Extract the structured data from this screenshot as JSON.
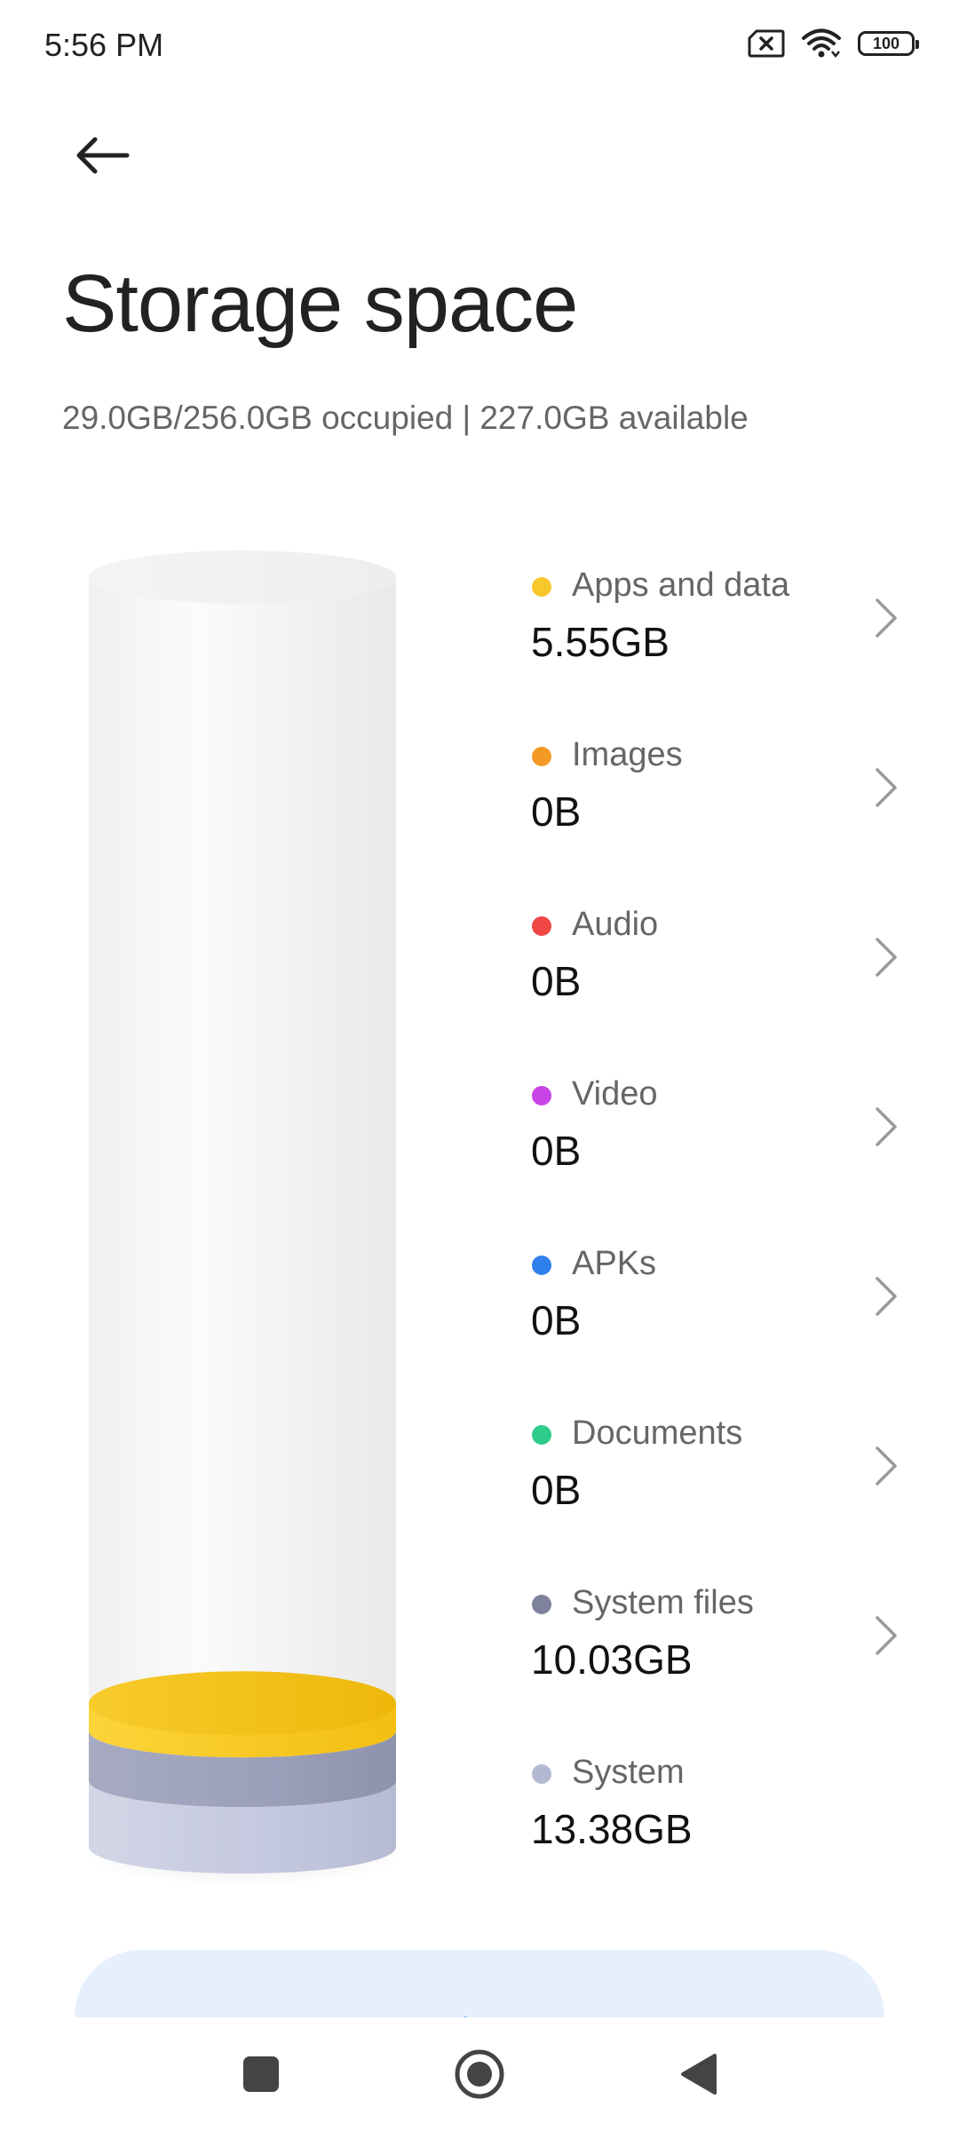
{
  "status_bar": {
    "time": "5:56 PM",
    "battery": "100",
    "icons": [
      "sim-disabled-icon",
      "wifi-icon",
      "battery-icon"
    ]
  },
  "header": {
    "back_icon": "arrow-left-icon",
    "title": "Storage space",
    "summary": "29.0GB/256.0GB occupied | 227.0GB available"
  },
  "chart_data": {
    "type": "stacked-cylinder",
    "total_gb": 256.0,
    "segments_bottom_to_top": [
      {
        "name": "System",
        "value_gb": 13.38,
        "color": "#b9bed6"
      },
      {
        "name": "System files",
        "value_gb": 10.03,
        "color": "#8e92ac"
      },
      {
        "name": "Apps and data",
        "value_gb": 5.55,
        "color": "#f5c11c"
      }
    ]
  },
  "categories": [
    {
      "label": "Apps and data",
      "value": "5.55GB",
      "color": "#f7c72b",
      "has_chevron": true
    },
    {
      "label": "Images",
      "value": "0B",
      "color": "#f39a26",
      "has_chevron": true
    },
    {
      "label": "Audio",
      "value": "0B",
      "color": "#f04646",
      "has_chevron": true
    },
    {
      "label": "Video",
      "value": "0B",
      "color": "#c844e6",
      "has_chevron": true
    },
    {
      "label": "APKs",
      "value": "0B",
      "color": "#2f80ed",
      "has_chevron": true
    },
    {
      "label": "Documents",
      "value": "0B",
      "color": "#2ecc8a",
      "has_chevron": true
    },
    {
      "label": "System files",
      "value": "10.03GB",
      "color": "#7f829c",
      "has_chevron": true
    },
    {
      "label": "System",
      "value": "13.38GB",
      "color": "#b4b9d3",
      "has_chevron": false
    }
  ],
  "actions": {
    "clear_label": "Clear",
    "accent_color": "#1477e6"
  },
  "nav_bar": {
    "icons": [
      "recents-square-icon",
      "home-circle-icon",
      "back-triangle-icon"
    ]
  }
}
